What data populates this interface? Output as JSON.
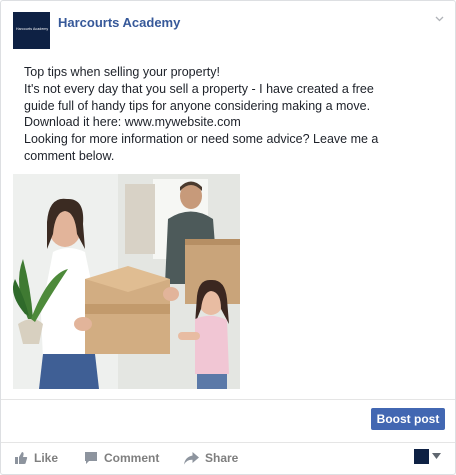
{
  "page": {
    "name": "Harcourts Academy",
    "avatar_text": "Harcourts Academy"
  },
  "post": {
    "lines": [
      "Top tips when selling your property!",
      "It's not every day that you sell a property - I have created a free",
      "guide full of handy tips for anyone considering making a move.",
      "Download it here: www.mywebsite.com",
      "Looking for more information or need some advice? Leave me a",
      "comment below."
    ]
  },
  "actions": {
    "boost_label": "Boost post",
    "like_label": "Like",
    "comment_label": "Comment",
    "share_label": "Share"
  },
  "icons": {
    "menu": "chevron-down-icon",
    "like": "thumbs-up-icon",
    "comment": "comment-bubble-icon",
    "share": "share-arrow-icon",
    "audience": "caret-down-icon"
  },
  "colors": {
    "brand_blue": "#365899",
    "button_blue": "#4267b2",
    "avatar_navy": "#0e2144",
    "action_gray": "#7f7f7f"
  }
}
